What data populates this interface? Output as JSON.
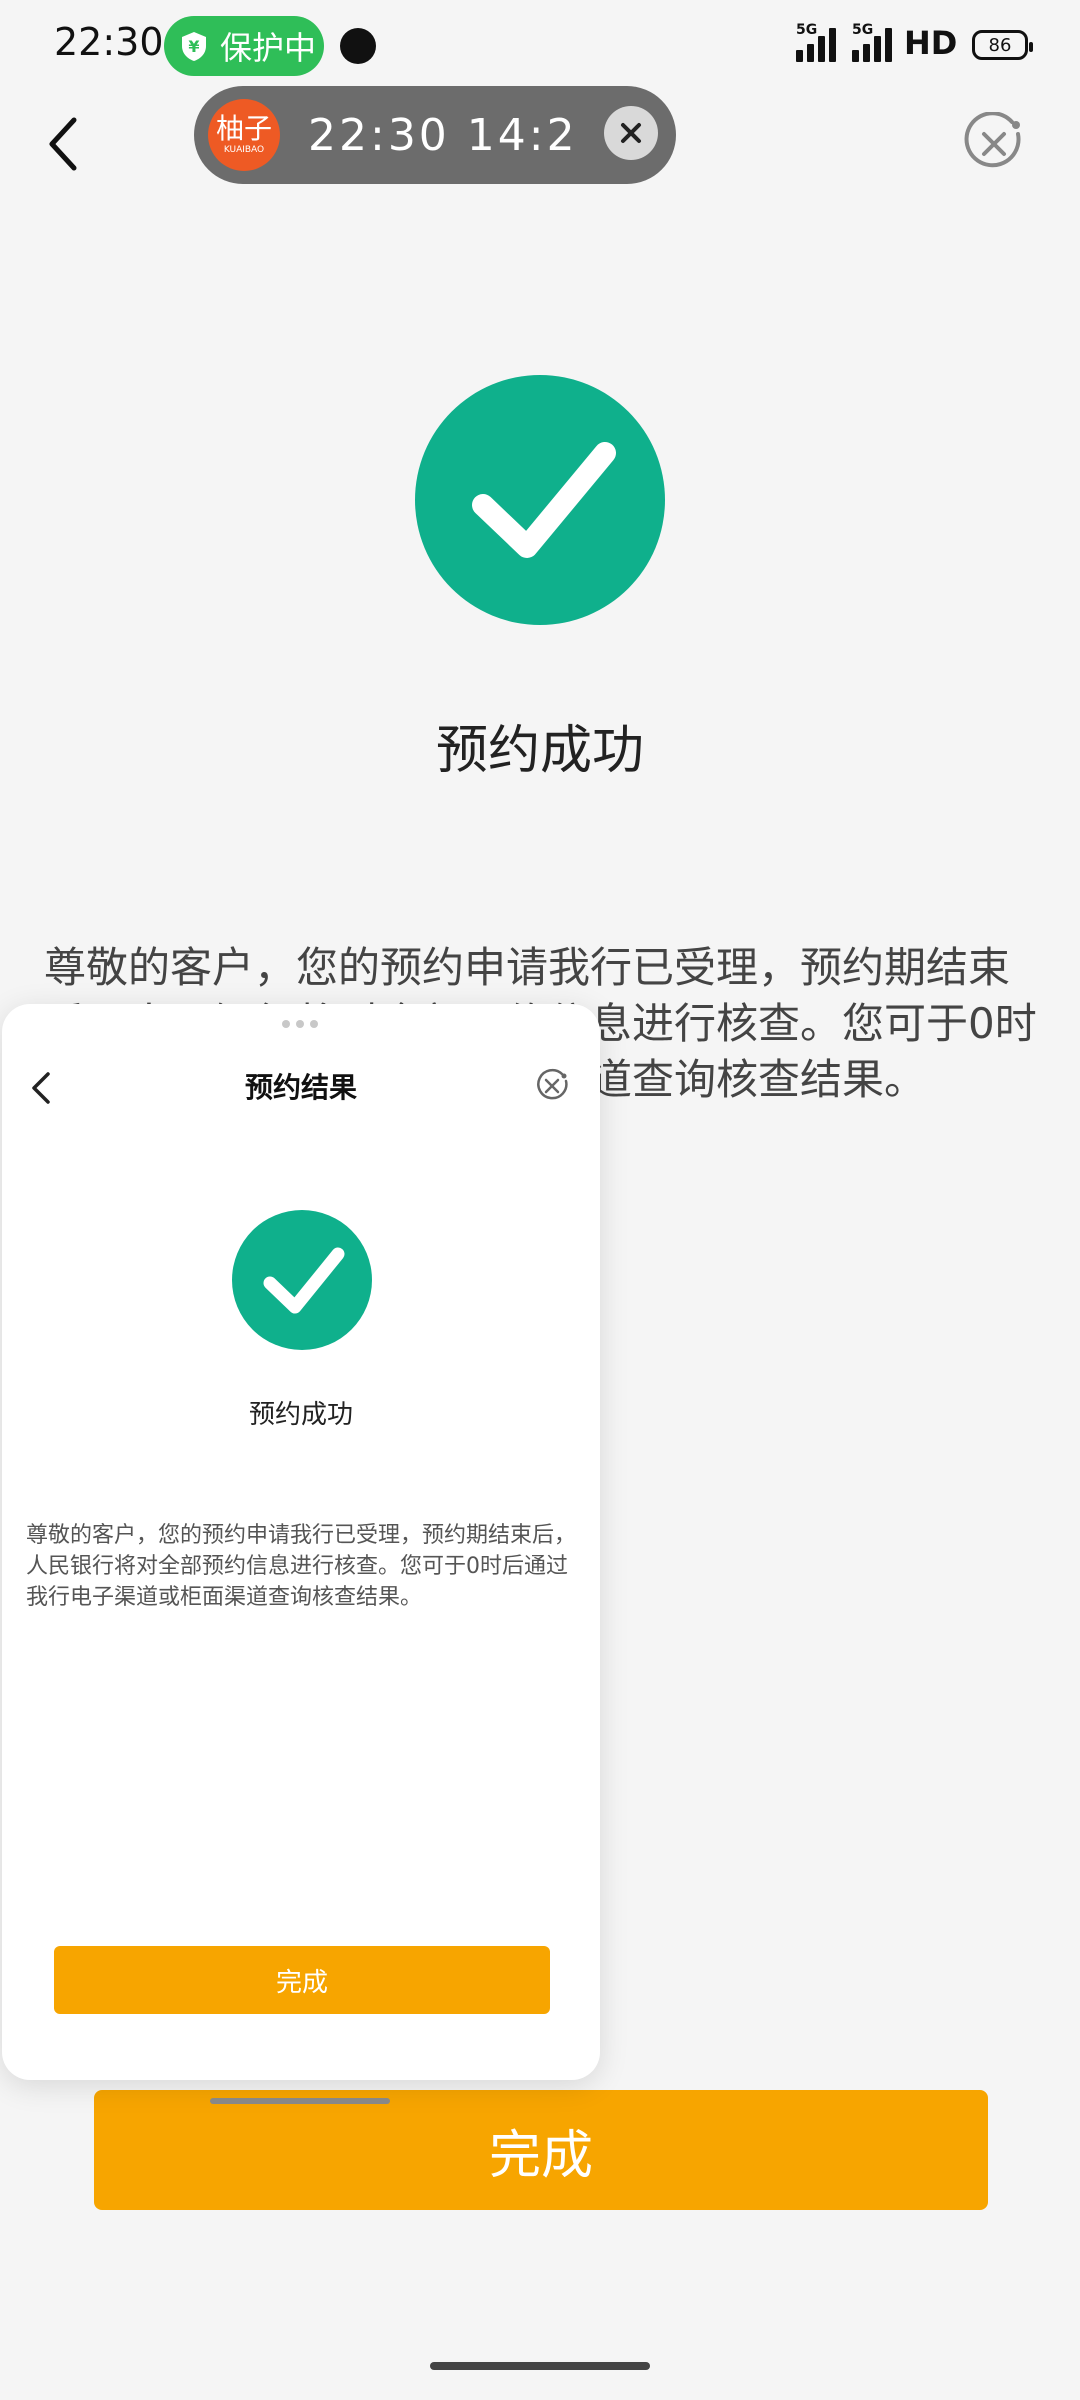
{
  "status_bar": {
    "time": "22:30",
    "protect_label": "保护中",
    "network_1": "5G",
    "network_2": "5G",
    "hd": "HD",
    "battery": "86"
  },
  "header": {
    "title": "预约结果"
  },
  "recorder": {
    "logo_text": "柚子",
    "logo_sub": "KUAIBAO",
    "time": "22:30 14:2"
  },
  "main": {
    "success_text": "预约成功",
    "description": "尊敬的客户，您的预约申请我行已受理，预约期结束后，人民银行将对全部预约信息进行核查。您可于0时后通过我行电子渠道或柜面渠道查询核查结果。",
    "done_label": "完成"
  },
  "overlay": {
    "title": "预约结果",
    "success_text": "预约成功",
    "description": "尊敬的客户，您的预约申请我行已受理，预约期结束后，人民银行将对全部预约信息进行核查。您可于0时后通过我行电子渠道或柜面渠道查询核查结果。",
    "done_label": "完成"
  }
}
